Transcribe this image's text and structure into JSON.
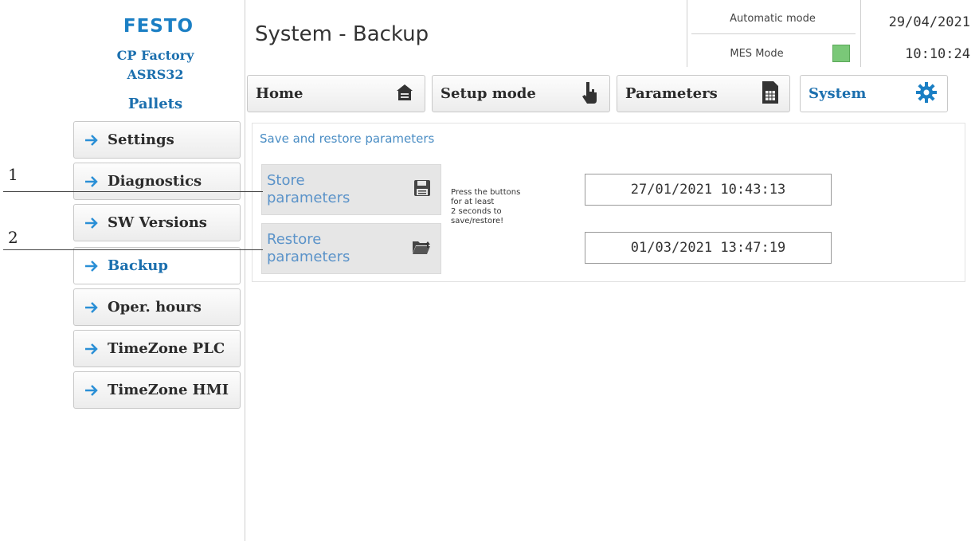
{
  "brand": {
    "logo": "FESTO",
    "line1": "CP Factory",
    "line2": "ASRS32",
    "line3": "Pallets"
  },
  "sidebar": {
    "items": [
      {
        "label": "Settings",
        "active": false
      },
      {
        "label": "Diagnostics",
        "active": false
      },
      {
        "label": "SW Versions",
        "active": false
      },
      {
        "label": "Backup",
        "active": true
      },
      {
        "label": "Oper. hours",
        "active": false
      },
      {
        "label": "TimeZone PLC",
        "active": false
      },
      {
        "label": "TimeZone HMI",
        "active": false
      }
    ]
  },
  "header": {
    "title": "System - Backup",
    "mode": "Automatic mode",
    "mes_mode": "MES Mode",
    "mes_color": "#7ac878",
    "date": "29/04/2021",
    "time": "10:10:24"
  },
  "tabs": [
    {
      "label": "Home",
      "icon": "home-icon"
    },
    {
      "label": "Setup mode",
      "icon": "hand-pointer-icon"
    },
    {
      "label": "Parameters",
      "icon": "document-table-icon"
    },
    {
      "label": "System",
      "icon": "gear-icon",
      "active": true
    }
  ],
  "main": {
    "section_title": "Save and restore parameters",
    "store_label_1": "Store",
    "store_label_2": "parameters",
    "restore_label_1": "Restore",
    "restore_label_2": "parameters",
    "hint": [
      "Press the buttons",
      "for at least",
      "2 seconds to",
      "save/restore!"
    ],
    "store_timestamp": "27/01/2021 10:43:13",
    "restore_timestamp": "01/03/2021 13:47:19"
  },
  "callouts": [
    "1",
    "2"
  ],
  "colors": {
    "accent": "#1b6fae",
    "brand": "#1b7fc4"
  }
}
